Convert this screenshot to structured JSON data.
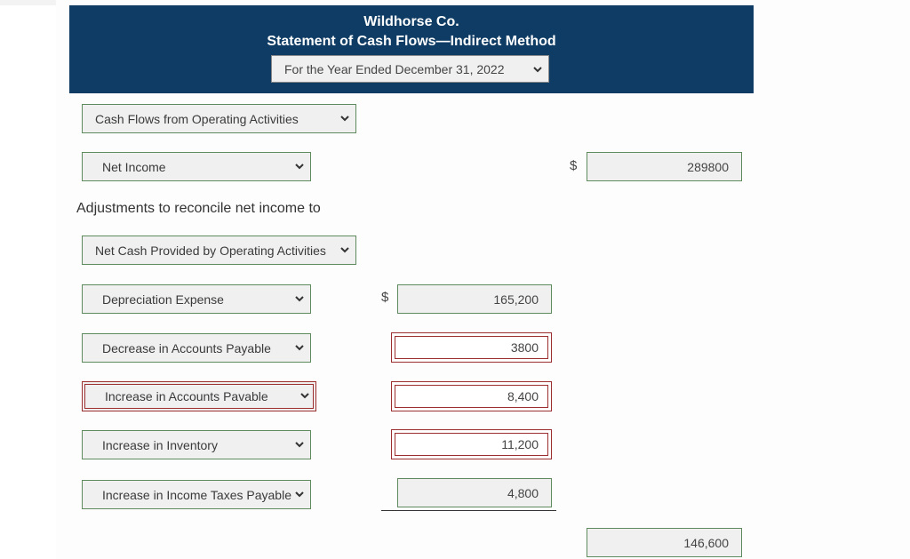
{
  "header": {
    "company": "Wildhorse Co.",
    "title": "Statement of Cash Flows—Indirect Method",
    "period": "For the Year Ended December 31, 2022"
  },
  "section_select": "Cash Flows from Operating Activities",
  "net_income": {
    "label": "Net Income",
    "currency": "$",
    "value": "289800"
  },
  "adjustments_text": "Adjustments to reconcile net income to",
  "adjustments_select": "Net Cash Provided by Operating Activities",
  "items": [
    {
      "label": "Depreciation Expense",
      "currency": "$",
      "value": "165,200"
    },
    {
      "label": "Decrease in Accounts Payable",
      "value": "3800"
    },
    {
      "label": "Increase in Accounts Pavable",
      "value": "8,400"
    },
    {
      "label": "Increase in Inventory",
      "value": "11,200"
    },
    {
      "label": "Increase in Income Taxes Payable",
      "value": "4,800"
    }
  ],
  "total": {
    "value": "146,600"
  },
  "colors": {
    "header_bg": "#0f3c64",
    "valid_border": "#5e8a5e",
    "error_border": "#9b2f2f"
  }
}
